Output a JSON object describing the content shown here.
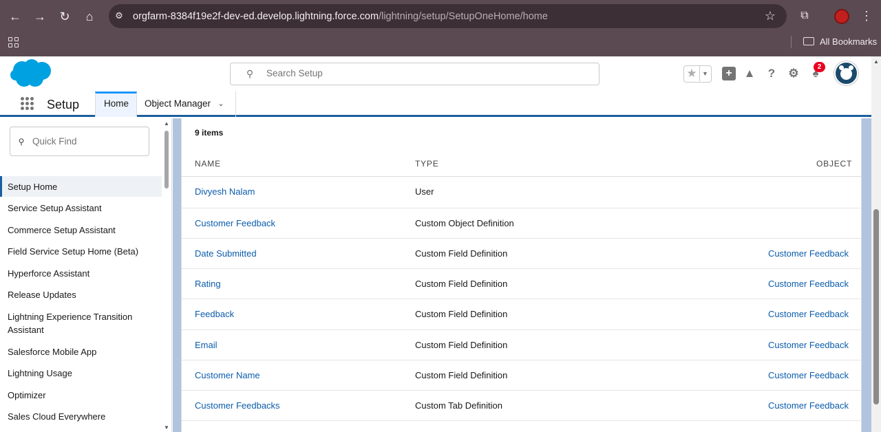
{
  "browser": {
    "url_host": "orgfarm-8384f19e2f-dev-ed.develop.lightning.force.com",
    "url_path": "/lightning/setup/SetupOneHome/home",
    "bookmarks_label": "All Bookmarks"
  },
  "header": {
    "search_placeholder": "Search Setup",
    "notification_count": "2"
  },
  "nav": {
    "app_name": "Setup",
    "tabs": [
      {
        "label": "Home",
        "active": true
      },
      {
        "label": "Object Manager",
        "active": false
      }
    ]
  },
  "sidebar": {
    "quick_find_placeholder": "Quick Find",
    "items": [
      {
        "label": "Setup Home",
        "active": true
      },
      {
        "label": "Service Setup Assistant"
      },
      {
        "label": "Commerce Setup Assistant"
      },
      {
        "label": "Field Service Setup Home (Beta)"
      },
      {
        "label": "Hyperforce Assistant"
      },
      {
        "label": "Release Updates"
      },
      {
        "label": "Lightning Experience Transition Assistant"
      },
      {
        "label": "Salesforce Mobile App"
      },
      {
        "label": "Lightning Usage"
      },
      {
        "label": "Optimizer"
      },
      {
        "label": "Sales Cloud Everywhere"
      }
    ]
  },
  "main": {
    "items_count": "9 items",
    "columns": {
      "name": "NAME",
      "type": "TYPE",
      "object": "OBJECT"
    },
    "rows": [
      {
        "name": "Divyesh Nalam",
        "type": "User",
        "object": ""
      },
      {
        "name": "Customer Feedback",
        "type": "Custom Object Definition",
        "object": ""
      },
      {
        "name": "Date Submitted",
        "type": "Custom Field Definition",
        "object": "Customer Feedback"
      },
      {
        "name": "Rating",
        "type": "Custom Field Definition",
        "object": "Customer Feedback"
      },
      {
        "name": "Feedback",
        "type": "Custom Field Definition",
        "object": "Customer Feedback"
      },
      {
        "name": "Email",
        "type": "Custom Field Definition",
        "object": "Customer Feedback"
      },
      {
        "name": "Customer Name",
        "type": "Custom Field Definition",
        "object": "Customer Feedback"
      },
      {
        "name": "Customer Feedbacks",
        "type": "Custom Tab Definition",
        "object": "Customer Feedback"
      }
    ]
  },
  "colors": {
    "chrome": "#5b4a52",
    "link": "#0b5cab",
    "brand_blue": "#1b96ff",
    "nav_underline": "#1b5f9e",
    "badge": "#ea001e"
  }
}
